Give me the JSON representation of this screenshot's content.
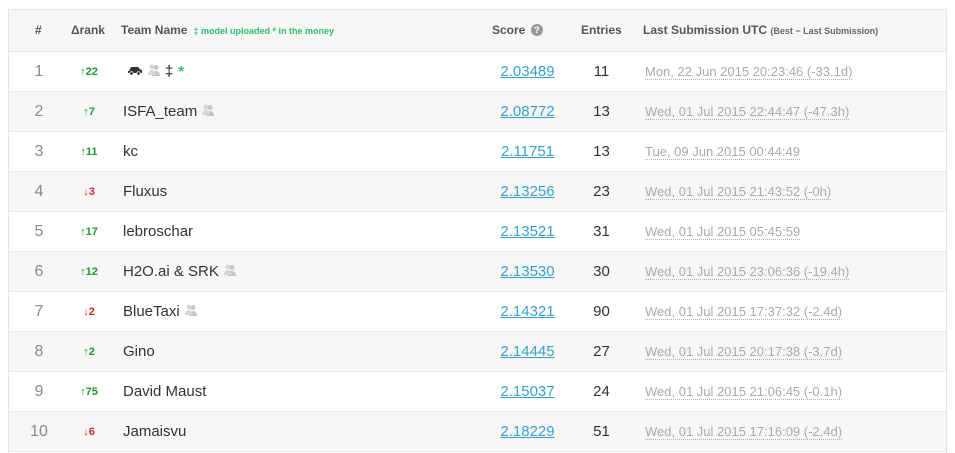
{
  "headers": {
    "rank": "#",
    "delta": "Δrank",
    "team": "Team Name",
    "legend": "‡ model uploaded * in the money",
    "score": "Score",
    "entries": "Entries",
    "last": "Last Submission UTC",
    "last_sub": "(Best − Last Submission)"
  },
  "rows": [
    {
      "rank": "1",
      "delta": "↑22",
      "dir": "up",
      "team": "",
      "score": "2.03489",
      "entries": "11",
      "last": "Mon, 22 Jun 2015 20:23:46 (-33.1d)"
    },
    {
      "rank": "2",
      "delta": "↑7",
      "dir": "up",
      "team": "ISFA_team",
      "score": "2.08772",
      "entries": "13",
      "last": "Wed, 01 Jul 2015 22:44:47 (-47.3h)"
    },
    {
      "rank": "3",
      "delta": "↑11",
      "dir": "up",
      "team": "kc",
      "score": "2.11751",
      "entries": "13",
      "last": "Tue, 09 Jun 2015 00:44:49"
    },
    {
      "rank": "4",
      "delta": "↓3",
      "dir": "down",
      "team": "Fluxus",
      "score": "2.13256",
      "entries": "23",
      "last": "Wed, 01 Jul 2015 21:43:52 (-0h)"
    },
    {
      "rank": "5",
      "delta": "↑17",
      "dir": "up",
      "team": "lebroschar",
      "score": "2.13521",
      "entries": "31",
      "last": "Wed, 01 Jul 2015 05:45:59"
    },
    {
      "rank": "6",
      "delta": "↑12",
      "dir": "up",
      "team": "H2O.ai & SRK",
      "score": "2.13530",
      "entries": "30",
      "last": "Wed, 01 Jul 2015 23:06:36 (-19.4h)"
    },
    {
      "rank": "7",
      "delta": "↓2",
      "dir": "down",
      "team": "BlueTaxi",
      "score": "2.14321",
      "entries": "90",
      "last": "Wed, 01 Jul 2015 17:37:32 (-2.4d)"
    },
    {
      "rank": "8",
      "delta": "↑2",
      "dir": "up",
      "team": "Gino",
      "score": "2.14445",
      "entries": "27",
      "last": "Wed, 01 Jul 2015 20:17:38 (-3.7d)"
    },
    {
      "rank": "9",
      "delta": "↑75",
      "dir": "up",
      "team": "David Maust",
      "score": "2.15037",
      "entries": "24",
      "last": "Wed, 01 Jul 2015 21:06:45 (-0.1h)"
    },
    {
      "rank": "10",
      "delta": "↓6",
      "dir": "down",
      "team": "Jamaisvu",
      "score": "2.18229",
      "entries": "51",
      "last": "Wed, 01 Jul 2015 17:16:09 (-2.4d)"
    }
  ],
  "row1_markers": {
    "dagger": "‡",
    "star": "*"
  },
  "team_icons": {
    "1": [
      "car-icon",
      "user-group-icon"
    ],
    "2": [
      "user-group-icon"
    ],
    "6": [
      "user-group-icon"
    ],
    "7": [
      "user-group-icon"
    ]
  },
  "colors": {
    "up": "#1f9a2e",
    "down": "#d42a2a",
    "score_link": "#3aa0c9",
    "legend": "#2fbf6f"
  }
}
